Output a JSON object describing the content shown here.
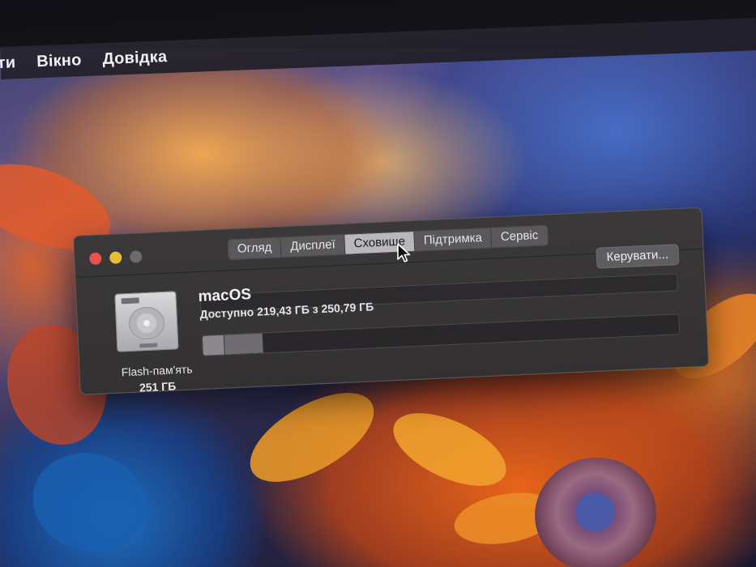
{
  "menubar": {
    "items": [
      {
        "label": "ти"
      },
      {
        "label": "Вікно"
      },
      {
        "label": "Довідка"
      }
    ]
  },
  "window": {
    "tabs": [
      {
        "label": "Огляд"
      },
      {
        "label": "Дисплеї"
      },
      {
        "label": "Сховище",
        "active": true
      },
      {
        "label": "Підтримка"
      },
      {
        "label": "Сервіс"
      }
    ],
    "manage_button": "Керувати...",
    "device": {
      "name": "Flash-пам'ять",
      "size": "251 ГБ",
      "icon": "hard-drive-icon"
    },
    "volume": {
      "name": "macOS",
      "available_text": "Доступно 219,43 ГБ з 250,79 ГБ",
      "used_fraction": 0.125,
      "segments": [
        {
          "fraction": 0.045,
          "color": "#8b898d"
        },
        {
          "fraction": 0.08,
          "color": "#6e6c70"
        }
      ]
    }
  },
  "colors": {
    "close": "#e6524e",
    "minimize": "#e8bd33",
    "zoom_disabled": "#6b6a6d"
  }
}
